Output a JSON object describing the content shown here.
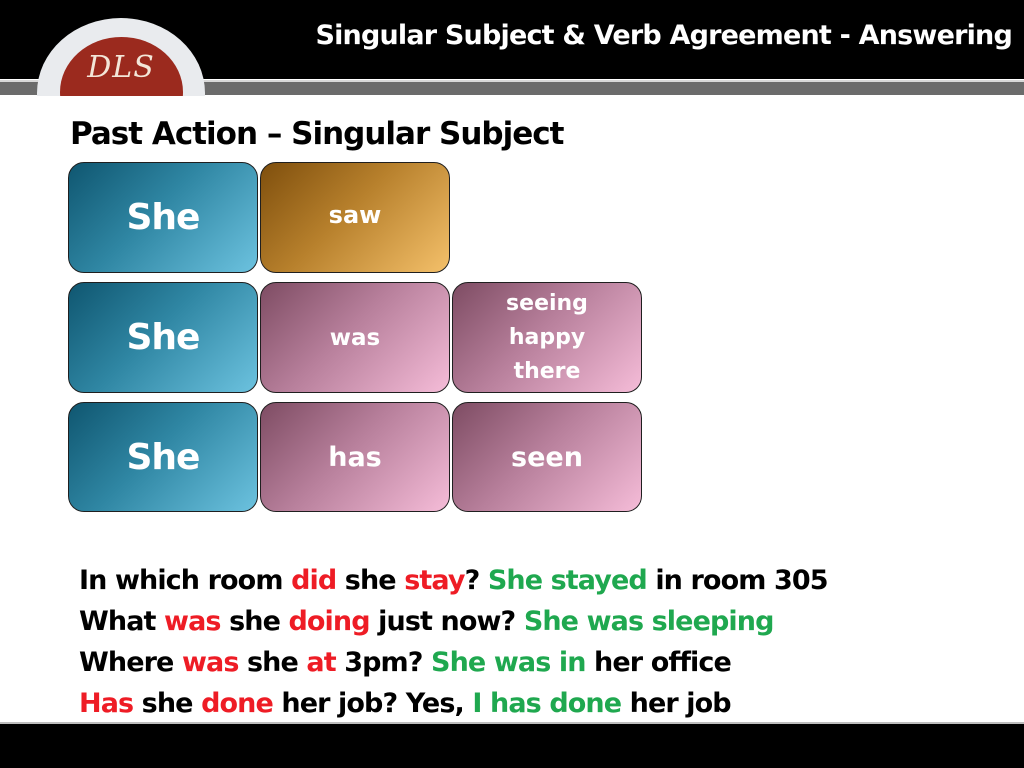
{
  "header": {
    "title": "Singular Subject & Verb Agreement - Answering",
    "logo_text": "DLS"
  },
  "section_title": "Past Action – Singular Subject",
  "grid": {
    "rows": [
      {
        "subject": "She",
        "verb": "saw",
        "complement_lines": []
      },
      {
        "subject": "She",
        "verb": "was",
        "complement_lines": [
          "seeing",
          "happy",
          "there"
        ]
      },
      {
        "subject": "She",
        "verb": "has",
        "complement_lines": [
          "seen"
        ]
      }
    ]
  },
  "colors": {
    "subject_box": "#2f86a3",
    "gold_box": "#b7802c",
    "pink_box": "#b77f9b",
    "question_highlight": "#ee1c25",
    "answer_highlight": "#1fa84f"
  },
  "sentences": [
    [
      {
        "text": "In which room ",
        "style": "plain"
      },
      {
        "text": "did",
        "style": "red"
      },
      {
        "text": " she ",
        "style": "plain"
      },
      {
        "text": "stay",
        "style": "red"
      },
      {
        "text": "? ",
        "style": "plain"
      },
      {
        "text": "She stayed",
        "style": "green"
      },
      {
        "text": " in room 305",
        "style": "plain"
      }
    ],
    [
      {
        "text": "What ",
        "style": "plain"
      },
      {
        "text": "was",
        "style": "red"
      },
      {
        "text": " she ",
        "style": "plain"
      },
      {
        "text": "doing",
        "style": "red"
      },
      {
        "text": " just now? ",
        "style": "plain"
      },
      {
        "text": "She was sleeping",
        "style": "green"
      }
    ],
    [
      {
        "text": "Where ",
        "style": "plain"
      },
      {
        "text": "was",
        "style": "red"
      },
      {
        "text": " she ",
        "style": "plain"
      },
      {
        "text": "at",
        "style": "red"
      },
      {
        "text": " 3pm? ",
        "style": "plain"
      },
      {
        "text": "She was in",
        "style": "green"
      },
      {
        "text": " her office",
        "style": "plain"
      }
    ],
    [
      {
        "text": "Has",
        "style": "red"
      },
      {
        "text": " she ",
        "style": "plain"
      },
      {
        "text": "done",
        "style": "red"
      },
      {
        "text": " her job? Yes, ",
        "style": "plain"
      },
      {
        "text": "I has done",
        "style": "green"
      },
      {
        "text": " her job",
        "style": "plain"
      }
    ]
  ]
}
